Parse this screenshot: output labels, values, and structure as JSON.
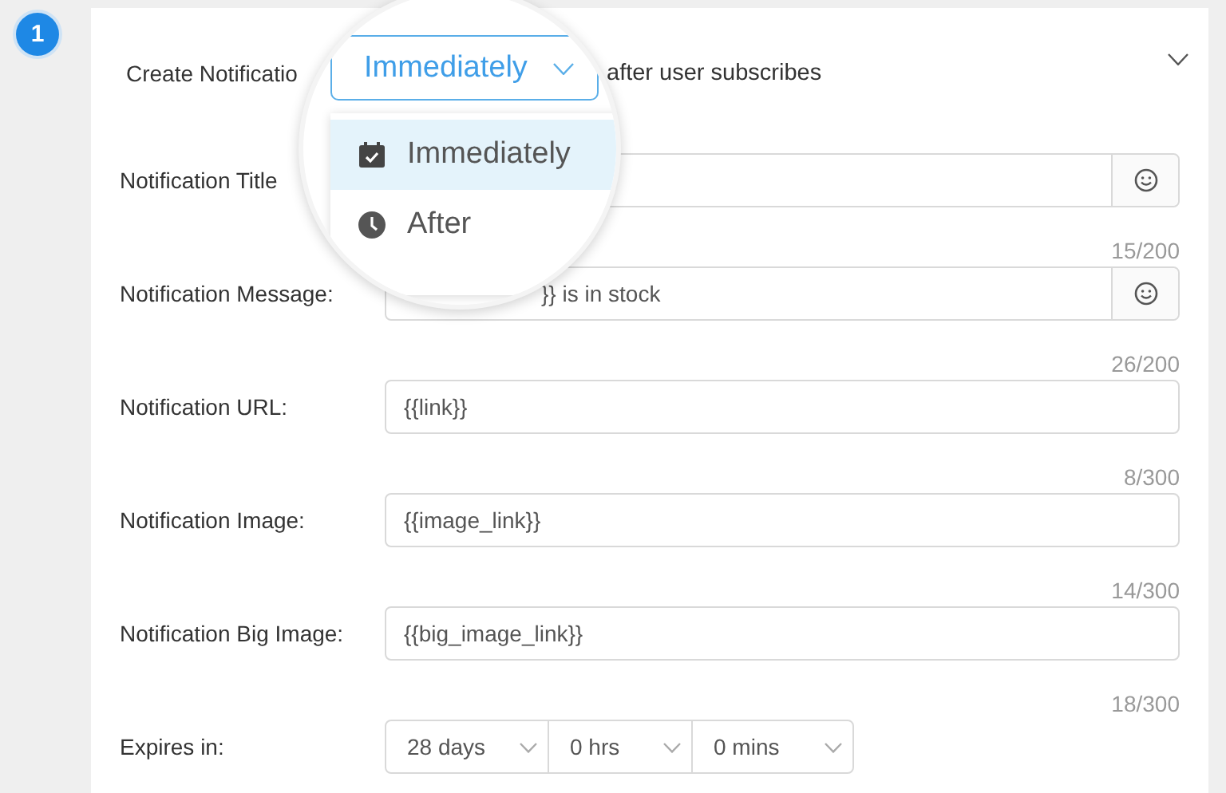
{
  "step": {
    "number": "1"
  },
  "header": {
    "label": "Create Notificatio",
    "suffix": "after user subscribes"
  },
  "magnifier": {
    "select": {
      "value": "Immediately"
    },
    "options": [
      {
        "label": "Immediately",
        "kind": "calendar",
        "selected": true
      },
      {
        "label": "After",
        "kind": "clock",
        "selected": false
      }
    ]
  },
  "fields": [
    {
      "label": "Notification Title",
      "counter": "15/200",
      "emoji": true
    },
    {
      "label": "Notification Message:",
      "value": "}} is in stock",
      "counter": "26/200",
      "emoji": true
    },
    {
      "label": "Notification URL:",
      "value": "{{link}}",
      "counter": "8/300",
      "emoji": false
    },
    {
      "label": "Notification Image:",
      "value": "{{image_link}}",
      "counter": "14/300",
      "emoji": false
    },
    {
      "label": "Notification Big Image:",
      "value": "{{big_image_link}}",
      "counter": "18/300",
      "emoji": false
    }
  ],
  "expires": {
    "label": "Expires in:",
    "selects": [
      "28 days",
      "0 hrs",
      "0 mins"
    ]
  }
}
